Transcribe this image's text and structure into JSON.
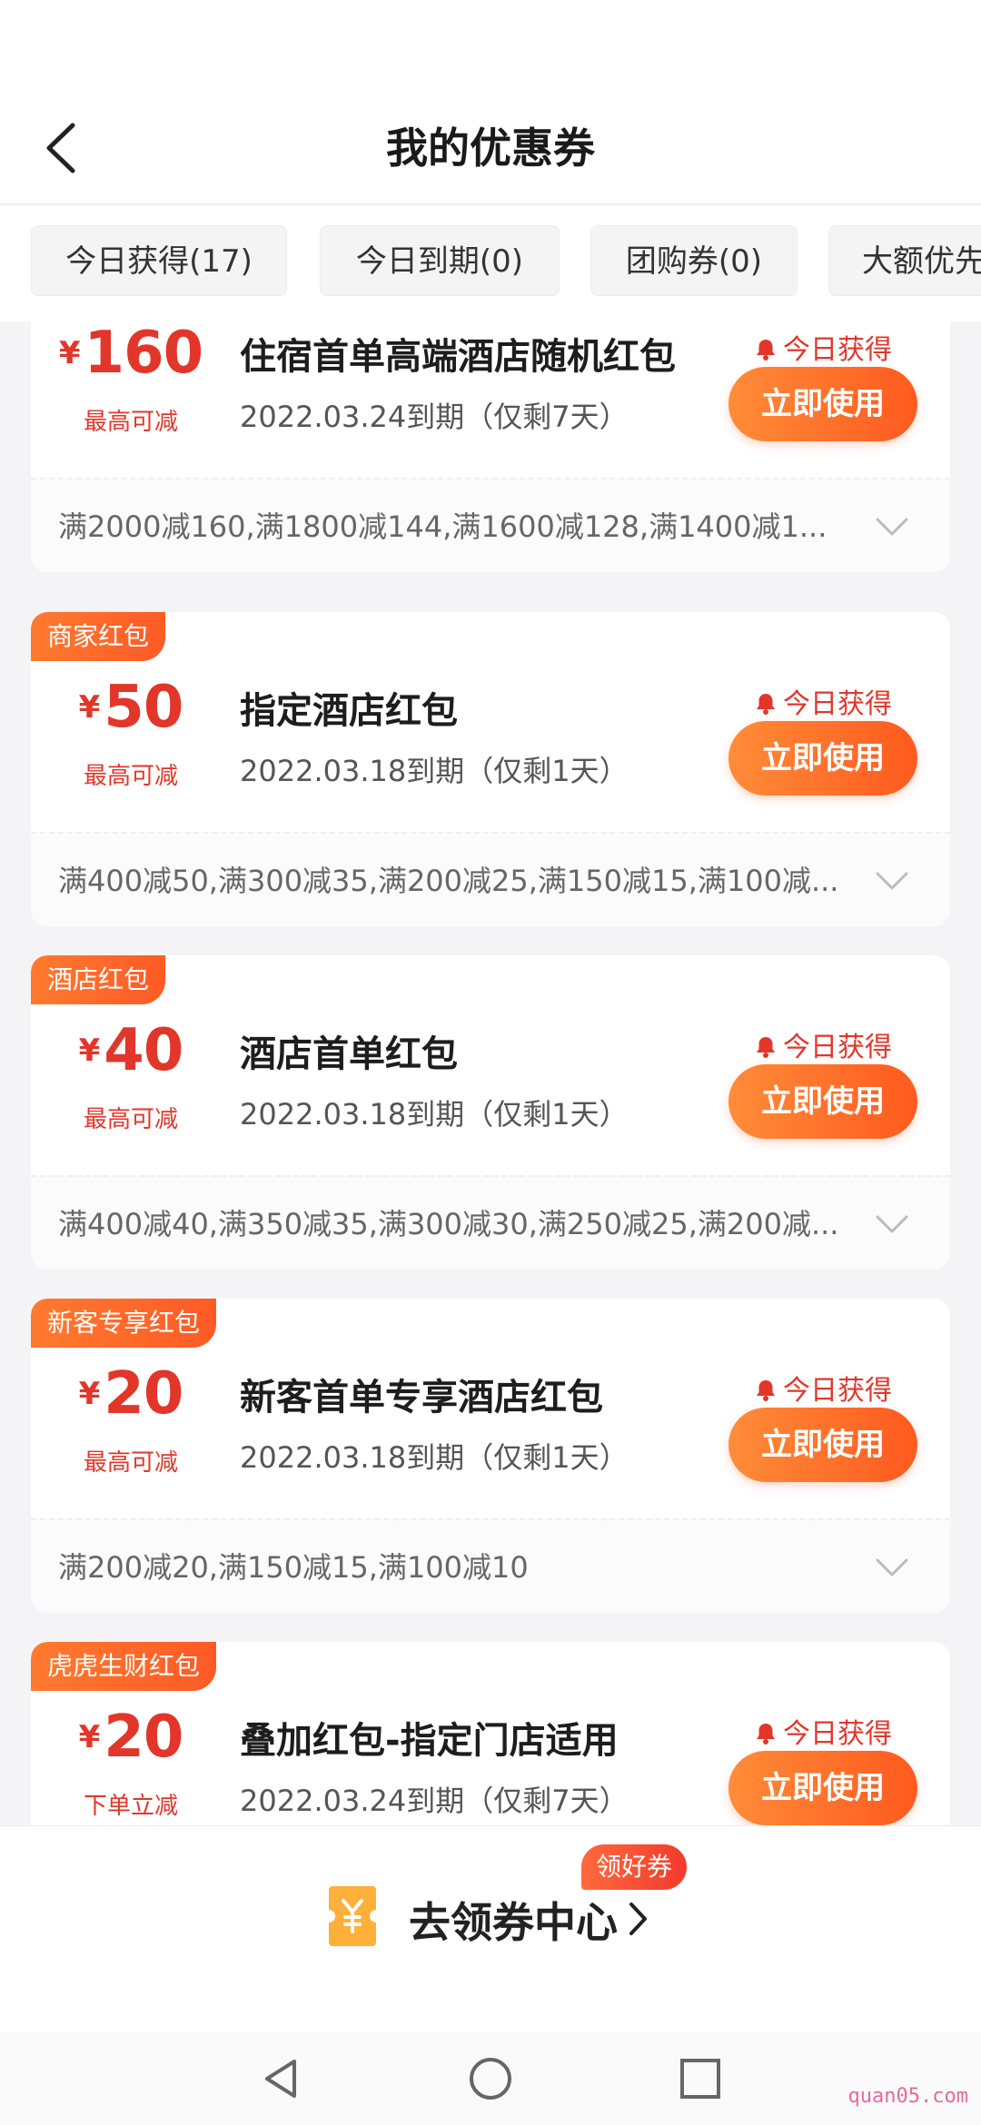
{
  "header": {
    "title": "我的优惠券"
  },
  "tabs": [
    {
      "label": "今日获得(17)"
    },
    {
      "label": "今日到期(0)"
    },
    {
      "label": "团购券(0)"
    },
    {
      "label": "大额优先"
    }
  ],
  "coupons": [
    {
      "tag": "",
      "currency": "¥",
      "amount": "160",
      "amount_note": "最高可减",
      "title": "住宿首单高端酒店随机红包",
      "expiry": "2022.03.24到期（仅剩7天）",
      "status": "今日获得",
      "action": "立即使用",
      "rules": "满2000减160,满1800减144,满1600减128,满1400减1..."
    },
    {
      "tag": "商家红包",
      "currency": "¥",
      "amount": "50",
      "amount_note": "最高可减",
      "title": "指定酒店红包",
      "expiry": "2022.03.18到期（仅剩1天）",
      "status": "今日获得",
      "action": "立即使用",
      "rules": "满400减50,满300减35,满200减25,满150减15,满100减..."
    },
    {
      "tag": "酒店红包",
      "currency": "¥",
      "amount": "40",
      "amount_note": "最高可减",
      "title": "酒店首单红包",
      "expiry": "2022.03.18到期（仅剩1天）",
      "status": "今日获得",
      "action": "立即使用",
      "rules": "满400减40,满350减35,满300减30,满250减25,满200减..."
    },
    {
      "tag": "新客专享红包",
      "currency": "¥",
      "amount": "20",
      "amount_note": "最高可减",
      "title": "新客首单专享酒店红包",
      "expiry": "2022.03.18到期（仅剩1天）",
      "status": "今日获得",
      "action": "立即使用",
      "rules": "满200减20,满150减15,满100减10"
    },
    {
      "tag": "虎虎生财红包",
      "currency": "¥",
      "amount": "20",
      "amount_note": "下单立减",
      "title": "叠加红包-指定门店适用",
      "expiry": "2022.03.24到期（仅剩7天）",
      "status": "今日获得",
      "action": "立即使用",
      "rules": ""
    }
  ],
  "bottom": {
    "coupon_center_label": "去领券中心",
    "badge": "领好券"
  },
  "watermark": "quan05.com",
  "colors": {
    "accent": "#ff5a1f",
    "price_red": "#e2362a",
    "tag_orange": "#ff6a2a"
  },
  "icons": {
    "back": "chevron-left-icon",
    "bell": "bell-icon",
    "expand": "chevron-down-icon",
    "ticket": "ticket-icon"
  }
}
